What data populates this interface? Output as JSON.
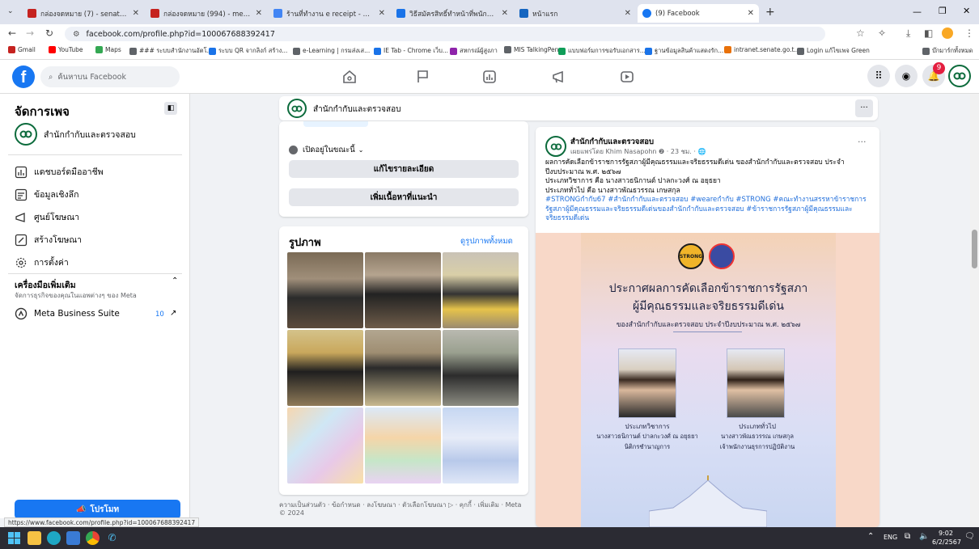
{
  "browser": {
    "tabs": [
      {
        "label": "กล่องจดหมาย (7) - senate93290",
        "color": "#c5221f"
      },
      {
        "label": "กล่องจดหมาย (994) - mew.tim.tk",
        "color": "#c5221f"
      },
      {
        "label": "ร้านที่ทำงาน e receipt - ค้นหาด้วย",
        "color": "#4285f4"
      },
      {
        "label": "วิธีสมัครสิทธิ์ทำหน้าที่พนักงานราชการ Easy",
        "color": "#1a73e8"
      },
      {
        "label": "หน้าแรก",
        "color": "#1565c0"
      },
      {
        "label": "(9) Facebook",
        "color": "#1877f2"
      }
    ],
    "new_tab_symbol": "+",
    "url": "facebook.com/profile.php?id=100067688392417",
    "bookmarks": [
      {
        "label": "Gmail",
        "color": "#c5221f"
      },
      {
        "label": "YouTube",
        "color": "#ff0000"
      },
      {
        "label": "Maps",
        "color": "#34a853"
      },
      {
        "label": "### ระบบสำนักงานอัตโ...",
        "color": "#5f6368"
      },
      {
        "label": "ระบบ QR จากลิงก์ สร้าง...",
        "color": "#1a73e8"
      },
      {
        "label": "e-Learning | กรมส่งเส...",
        "color": "#5f6368"
      },
      {
        "label": "IE Tab - Chrome เว็บ...",
        "color": "#1a73e8"
      },
      {
        "label": "สหกรณ์ผู้สูงภา",
        "color": "#8e24aa"
      },
      {
        "label": "MIS TalkingPen",
        "color": "#5f6368"
      },
      {
        "label": "แบบฟอร์มการขอรับเอกสาร...",
        "color": "#0f9d58"
      },
      {
        "label": "ฐานข้อมูลสินค้าแสดงรัก...",
        "color": "#1a73e8"
      },
      {
        "label": "intranet.senate.go.t...",
        "color": "#e8710a"
      },
      {
        "label": "Login แก้ไขเพจ Green",
        "color": "#5f6368"
      },
      {
        "label": "บ๊กมาร์กทั้งหมด",
        "color": "#5f6368"
      }
    ]
  },
  "fb": {
    "search_placeholder": "ค้นหาบน Facebook",
    "notification_count": "9",
    "left": {
      "title": "จัดการเพจ",
      "page_name": "สำนักกำกับและตรวจสอบ",
      "items": [
        "แดชบอร์ดมืออาชีพ",
        "ข้อมูลเชิงลึก",
        "ศูนย์โฆษณา",
        "สร้างโฆษณา",
        "การตั้งค่า"
      ],
      "tools_title": "เครื่องมือเพิ่มเติม",
      "tools_sub": "จัดการธุรกิจของคุณในแอพต่างๆ ของ Meta",
      "mbs_label": "Meta Business Suite",
      "mbs_count": "10",
      "promote_label": "โปรโมท",
      "status_url": "https://www.facebook.com/profile.php?id=100067688392417"
    },
    "page_bar_name": "สำนักกำกับและตรวจสอบ",
    "page_bar_more": "···",
    "intro": {
      "open_now": "เปิดอยู่ในขณะนี้",
      "edit_details": "แก้ไขรายละเอียด",
      "add_featured": "เพิ่มเนื้อหาที่แนะนำ"
    },
    "photos": {
      "title": "รูปภาพ",
      "see_all": "ดูรูปภาพทั้งหมด"
    },
    "footer": "ความเป็นส่วนตัว · ข้อกำหนด · ลงโฆษณา · ตัวเลือกโฆษณา ▷ · คุกกี้ · เพิ่มเติม · Meta © 2024",
    "post": {
      "author": "สำนักกำกับและตรวจสอบ",
      "meta": "เผยแพร่โดย Khim Nasapohn ❷ · 23 ชม. · 🌐",
      "more": "···",
      "text1": "ผลการคัดเลือกข้าราชการรัฐสภาผู้มีคุณธรรมและจริยธรรมดีเด่น ของสำนักกำกับและตรวจสอบ ประจำปีงบประมาณ พ.ศ. ๒๕๖๗",
      "text2": "ประเภทวิชาการ  คือ  นางสาวธนิกานต์  ปาลกะวงศ์ ณ อยุธยา",
      "text3": "ประเภททั่วไป    คือ  นางสาวพัณธวรรณ  เกษสกุล",
      "hashtags": "#STRONGกำกับ67 #สำนักกำกับและตรวจสอบ #weareกำกับ #STRONG #คณะทำงานสรรหาข้าราชการรัฐสภาผู้มีคุณธรรมและจริยธรรมดีเด่นของสำนักกำกับและตรวจสอบ #ข้าราชการรัฐสภาผู้มีคุณธรรมและจริยธรรมดีเด่น",
      "poster": {
        "logo_text": "STRONG",
        "line1": "ประกาศผลการคัดเลือกข้าราชการรัฐสภา",
        "line2": "ผู้มีคุณธรรมและจริยธรรมดีเด่น",
        "line3": "ของสำนักกำกับและตรวจสอบ ประจำปีงบประมาณ พ.ศ. ๒๕๖๗",
        "left_type": "ประเภทวิชาการ",
        "left_name": "นางสาวธนิกานต์  ปาลกะวงศ์ ณ อยุธยา",
        "left_pos": "นิติกรชำนาญการ",
        "right_type": "ประเภททั่วไป",
        "right_name": "นางสาวพัณธวรรณ  เกษสกุล",
        "right_pos": "เจ้าพนักงานธุรการปฏิบัติงาน"
      }
    }
  },
  "taskbar": {
    "lang": "ENG",
    "time": "9:02",
    "date": "6/2/2567"
  },
  "colors": {
    "fb_blue": "#1877f2",
    "brand_green": "#0c6b3c"
  }
}
